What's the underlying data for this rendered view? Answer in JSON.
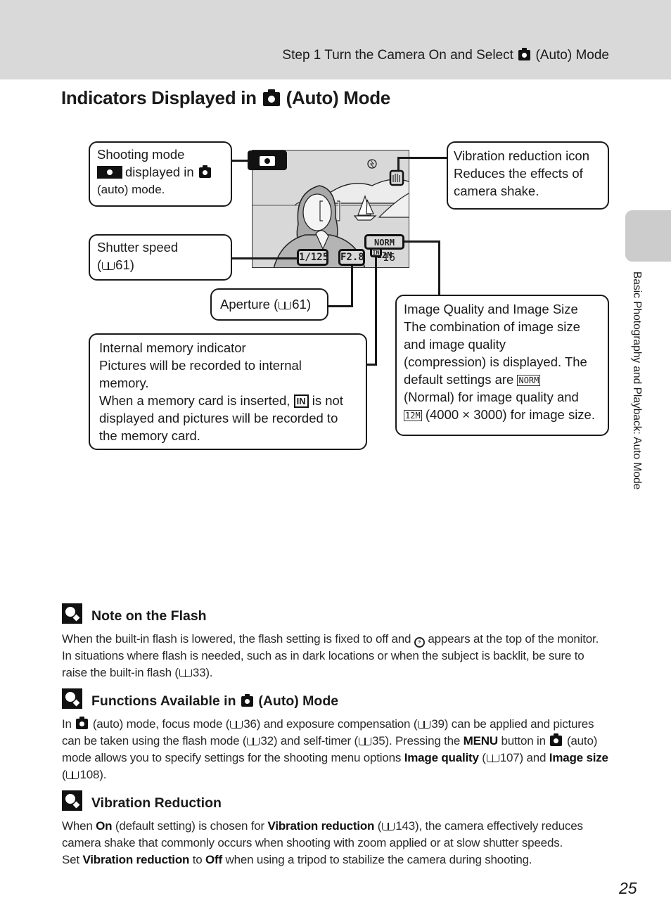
{
  "header": {
    "running_head_pre": "Step 1 Turn the Camera On and Select",
    "running_head_post": "(Auto) Mode",
    "mode_icon": "camera-auto-icon"
  },
  "page_title": {
    "pre": "Indicators Displayed in",
    "post": "(Auto) Mode"
  },
  "monitor": {
    "shutter_speed": "1/125",
    "aperture": "F2.8",
    "image_quality": "NORM",
    "image_size": "12M",
    "memory": "IN",
    "exposures_remaining": "16",
    "icons": [
      "shooting-mode-icon",
      "flash-off-icon",
      "vibration-reduction-icon",
      "focus-area-brackets"
    ]
  },
  "callouts": {
    "shooting_mode": {
      "line1": "Shooting mode",
      "line2": "displayed in",
      "line3": "(auto) mode."
    },
    "shutter_speed": {
      "line1": "Shutter speed",
      "line2_pre": "(",
      "line2_ref": "61)"
    },
    "aperture": {
      "pre": "Aperture (",
      "ref": "61)"
    },
    "internal_memory": {
      "line1": "Internal memory indicator",
      "line2": "Pictures will be recorded to internal",
      "line3": "memory.",
      "line4_pre": "When a memory card is inserted,",
      "line4_glyph": "IN",
      "line4_post": "is not",
      "line5": "displayed and pictures will be recorded to",
      "line6": "the memory card."
    },
    "vibration_reduction": {
      "line1": "Vibration reduction icon",
      "line2": "Reduces the effects of",
      "line3": "camera shake."
    },
    "image_quality": {
      "line1": "Image Quality and Image Size",
      "line2": "The combination of image size",
      "line3": "and image quality",
      "line4": "(compression) is displayed. The",
      "line5_pre": "default settings are",
      "line5_glyph": "NORM",
      "line6": "(Normal) for image quality and",
      "line7_glyph": "12M",
      "line7_post": "(4000 × 3000) for image size."
    }
  },
  "side_tab": {
    "label": "Basic Photography and Playback: Auto Mode"
  },
  "notes": [
    {
      "icon": "note-icon",
      "title": "Note on the Flash",
      "p1_a": "When the built-in flash is lowered, the flash setting is fixed to off and",
      "p1_b": "appears at the top of the monitor. In situations where flash is needed, such as in dark locations or when the subject is backlit, be sure to raise the built-in flash (",
      "p1_c": "33)."
    },
    {
      "icon": "note-icon",
      "title_pre": "Functions Available in",
      "title_post": "(Auto) Mode",
      "t1": "In",
      "t2": "(auto) mode, focus mode (",
      "t3": "36) and exposure compensation (",
      "t4": "39) can be applied and pictures can be taken using the flash mode (",
      "t5": "32) and self-timer (",
      "t6": "35). Pressing the",
      "menu": "MENU",
      "t7": "button in",
      "t8": "(auto) mode allows you to specify settings for the shooting menu options",
      "b1": "Image quality",
      "t9": "(",
      "t10": "107) and",
      "b2": "Image size",
      "t11": "(",
      "t12": "108)."
    },
    {
      "icon": "note-icon",
      "title": "Vibration Reduction",
      "t1": "When",
      "b1": "On",
      "t2": "(default setting) is chosen for",
      "b2": "Vibration reduction",
      "t3": "(",
      "t4": "143), the camera effectively reduces camera shake that commonly occurs when shooting with zoom applied or at slow shutter speeds.",
      "t5": "Set",
      "b3": "Vibration reduction",
      "t6": "to",
      "b4": "Off",
      "t7": "when using a tripod to stabilize the camera during shooting."
    }
  ],
  "page_number": "25"
}
